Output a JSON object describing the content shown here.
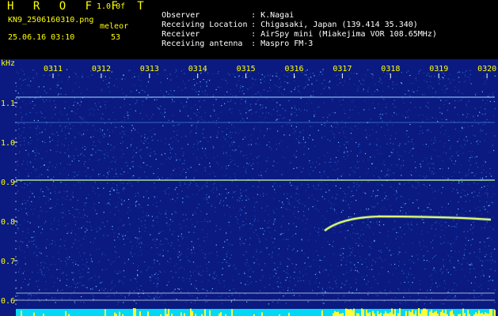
{
  "header": {
    "app_title": "H R O F F T",
    "version": "1.0.0f",
    "filename": "KN9_2506160310.png",
    "mode": "meleor",
    "datetime": "25.06.16 03:10",
    "count": "53",
    "info": [
      {
        "key": "Observer",
        "value": "K.Nagai"
      },
      {
        "key": "Receiving Location",
        "value": "Chigasaki, Japan (139.414 35.340)"
      },
      {
        "key": "Receiver",
        "value": "AirSpy mini (Miakejima VOR 108.65MHz)"
      },
      {
        "key": "Receiving antenna",
        "value": "Maspro FM-3"
      }
    ]
  },
  "spectrogram": {
    "unit_label": "kHz",
    "time_labels": [
      "0311",
      "0312",
      "0313",
      "0314",
      "0315",
      "0316",
      "0317",
      "0318",
      "0319",
      "0320"
    ],
    "freq_labels": [
      "1.1",
      "1.0",
      "0.9",
      "0.8",
      "0.7",
      "0.6"
    ],
    "colors": {
      "background": "#0a1a80",
      "noise_bright": "#4aa3ff",
      "signal": "#ffff66",
      "bottom_bar": "#00e5ff"
    }
  }
}
